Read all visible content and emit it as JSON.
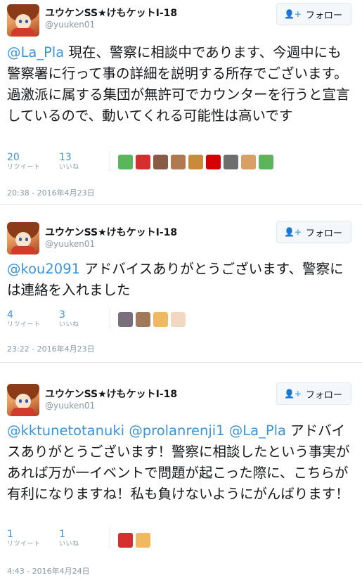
{
  "tweets": [
    {
      "author": "ユウケンSS★けもケットI-18",
      "handle": "@yuuken01",
      "follow_label": "フォロー",
      "text_parts": [
        {
          "t": "@La_Pla",
          "m": true
        },
        {
          "t": " 現在、警察に相談中であります、今週中にも警察署に行って事の詳細を説明する所存でございます。過激派に属する集団が無許可でカウンターを行うと宣言しているので、動いてくれる可能性は高いです",
          "m": false
        }
      ],
      "retweets": "20",
      "retweets_label": "リツイート",
      "likes": "13",
      "likes_label": "いいね",
      "liker_colors": [
        "#5bb55b",
        "#d32f2f",
        "#8a5a44",
        "#b07850",
        "#c98b3a",
        "#d50000",
        "#6e6e6e",
        "#d9a066",
        "#5bb55b"
      ],
      "date": "20:38 - 2016年4月23日"
    },
    {
      "author": "ユウケンSS★けもケットI-18",
      "handle": "@yuuken01",
      "follow_label": "フォロー",
      "text_parts": [
        {
          "t": "@kou2091",
          "m": true
        },
        {
          "t": " アドバイスありがとうございます、警察には連絡を入れました",
          "m": false
        }
      ],
      "retweets": "4",
      "retweets_label": "リツイート",
      "likes": "3",
      "likes_label": "いいね",
      "liker_colors": [
        "#7a6e7c",
        "#a0785a",
        "#f0b860",
        "#f2d7c3"
      ],
      "date": "23:22 - 2016年4月23日"
    },
    {
      "author": "ユウケンSS★けもケットI-18",
      "handle": "@yuuken01",
      "follow_label": "フォロー",
      "text_parts": [
        {
          "t": "@kktunetotanuki",
          "m": true
        },
        {
          "t": " ",
          "m": false
        },
        {
          "t": "@prolanrenji1",
          "m": true
        },
        {
          "t": " ",
          "m": false
        },
        {
          "t": "@La_Pla",
          "m": true
        },
        {
          "t": " アドバイスありがとうございます！警察に相談したという事実があれば万が一イベントで問題が起こった際に、こちらが有利になりますね！私も負けないようにがんばります！",
          "m": false
        }
      ],
      "retweets": "1",
      "retweets_label": "リツイート",
      "likes": "1",
      "likes_label": "いいね",
      "liker_colors": [
        "#d32f2f",
        "#f0b860"
      ],
      "date": "4:43 - 2016年4月24日"
    }
  ]
}
